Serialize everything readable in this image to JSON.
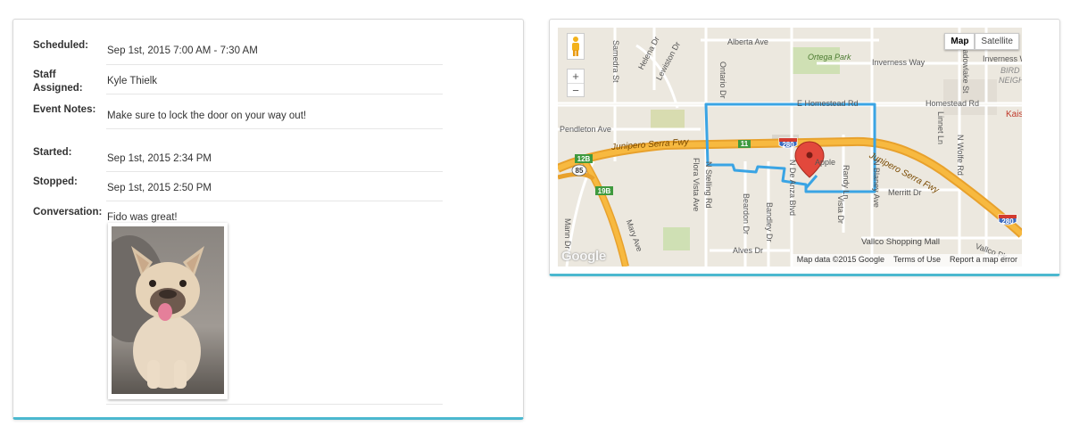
{
  "details": {
    "scheduled": {
      "label": "Scheduled:",
      "value": "Sep 1st, 2015 7:00 AM - 7:30 AM"
    },
    "staff": {
      "label_line1": "Staff",
      "label_line2": "Assigned:",
      "value": "Kyle Thielk"
    },
    "notes": {
      "label": "Event Notes:",
      "value": "Make sure to lock the door on your way out!"
    },
    "started": {
      "label": "Started:",
      "value": "Sep 1st, 2015 2:34 PM"
    },
    "stopped": {
      "label": "Stopped:",
      "value": "Sep 1st, 2015 2:50 PM"
    },
    "conversation": {
      "label": "Conversation:",
      "value": "Fido was great!"
    }
  },
  "map": {
    "map_type": {
      "map": "Map",
      "satellite": "Satellite"
    },
    "zoom_in": "+",
    "zoom_out": "−",
    "streets": {
      "alberta": "Alberta Ave",
      "ortega": "Ortega Park",
      "inverness": "Inverness Way",
      "inverness2": "Inverness W",
      "homestead_e": "E Homestead Rd",
      "homestead": "Homestead Rd",
      "pendleton": "Pendleton Ave",
      "junipero_w": "Junipero Serra Fwy",
      "junipero_e": "Junipero Serra Fwy",
      "merritt": "Merritt Dr",
      "alves": "Alves Dr",
      "vallco": "Vallco Shopping Mall",
      "vallco_pkwy": "Vallco Pk",
      "samedra": "Samedra St",
      "helena": "Helena Dr",
      "lewiston": "Lewiston Dr",
      "ontario": "Ontario Dr",
      "fiora": "Flora Vista Ave",
      "stelling": "N Stelling Rd",
      "beardon": "Beardon Dr",
      "bandley": "Bandley Dr",
      "de_anza": "N De Anza Blvd",
      "randy": "Randy Ln",
      "vista": "Vista Dr",
      "blaney": "N Blaney Ave",
      "linnet": "Linnet Ln",
      "wolfe": "N Wolfe Rd",
      "meadowlake": "Meadowlake St",
      "mann": "Mann Dr",
      "mary": "Mary Ave",
      "apple": "Apple",
      "kais": "Kais",
      "bird": "BIRD",
      "neigh": "NEIGH"
    },
    "shields": {
      "i280a": "280",
      "i280b": "280",
      "r85": "85",
      "r11": "11",
      "r12b": "12B",
      "r19b": "19B"
    },
    "footer": {
      "data": "Map data ©2015 Google",
      "terms": "Terms of Use",
      "report": "Report a map error"
    },
    "logo": "Google"
  }
}
